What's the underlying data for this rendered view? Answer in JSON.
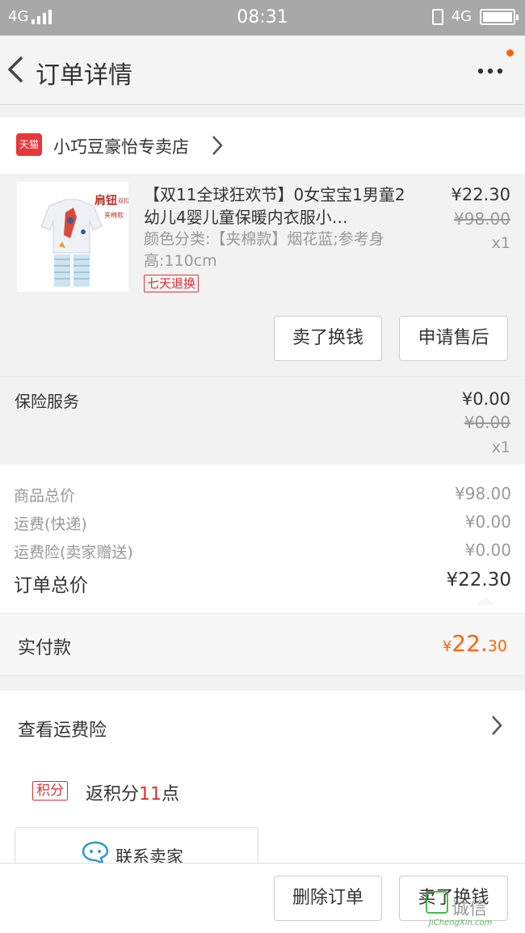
{
  "status_bar": {
    "network_left": "4G",
    "time": "08:31",
    "network_right": "4G"
  },
  "nav": {
    "title": "订单详情"
  },
  "shop": {
    "badge": "天猫",
    "name": "小巧豆豪怡专卖店"
  },
  "product": {
    "title": "【双11全球狂欢节】0女宝宝1男童2幼儿4婴儿童保暖内衣服小…",
    "sku": "颜色分类:【夹棉款】烟花蓝;参考身高:110cm",
    "return_badge": "七天退换",
    "price": "¥22.30",
    "original_price": "¥98.00",
    "quantity": "x1",
    "thumb_text_1": "肩钮",
    "thumb_text_2": "双扣",
    "thumb_text_3": "夹棉款",
    "buttons": {
      "sell": "卖了换钱",
      "after_sale": "申请售后"
    }
  },
  "insurance": {
    "label": "保险服务",
    "price": "¥0.00",
    "original_price": "¥0.00",
    "quantity": "x1"
  },
  "summary": {
    "rows": [
      {
        "label": "商品总价",
        "value": "¥98.00"
      },
      {
        "label": "运费(快递)",
        "value": "¥0.00"
      },
      {
        "label": "运费险(卖家赠送)",
        "value": "¥0.00"
      }
    ],
    "total_label": "订单总价",
    "total_value": "¥22.30"
  },
  "paid": {
    "label": "实付款",
    "currency": "¥",
    "integer": "22.",
    "decimal": "30"
  },
  "lower": {
    "insurance_link": "查看运费险",
    "points_badge": "积分",
    "points_prefix": "返积分",
    "points_num": "11",
    "points_suffix": "点",
    "contact_label": "联系卖家"
  },
  "bottom": {
    "delete": "删除订单",
    "sell": "卖了换钱"
  },
  "watermark": {
    "text": "诚信",
    "sub": "JiChengXin.com"
  },
  "colors": {
    "accent": "#ff6600",
    "badge_red": "#dd3333",
    "status_bar": "#a8a8a8"
  }
}
